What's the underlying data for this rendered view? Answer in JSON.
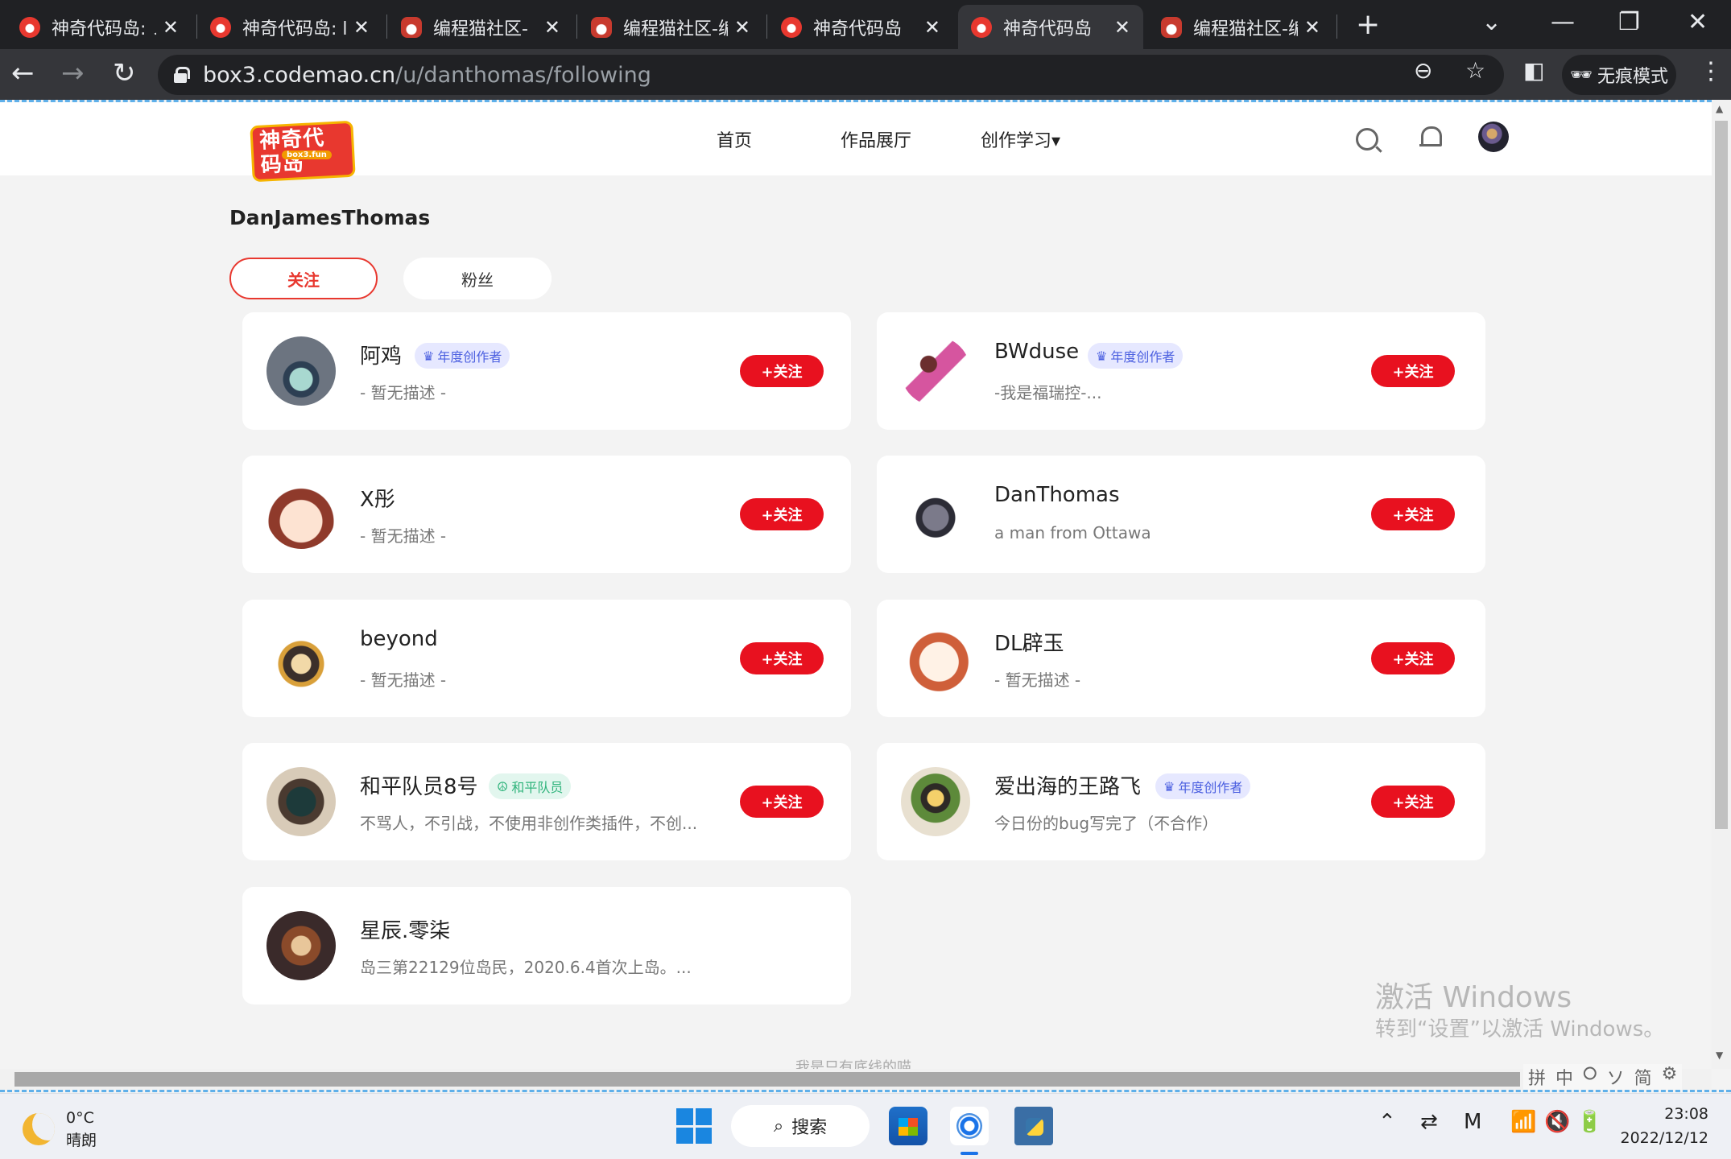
{
  "browser": {
    "tabs": [
      {
        "title": "神奇代码岛: ノ",
        "icon": "red-star",
        "active": false
      },
      {
        "title": "神奇代码岛: l",
        "icon": "red-star",
        "active": false
      },
      {
        "title": "编程猫社区-",
        "icon": "cat",
        "active": false
      },
      {
        "title": "编程猫社区-编",
        "icon": "cat",
        "active": false
      },
      {
        "title": "神奇代码岛",
        "icon": "red-star",
        "active": false
      },
      {
        "title": "神奇代码岛",
        "icon": "red-star",
        "active": true
      },
      {
        "title": "编程猫社区-编",
        "icon": "cat",
        "active": false
      }
    ],
    "url_host": "box3.codemao.cn",
    "url_path": "/u/danthomas/following",
    "incognito_label": "无痕模式"
  },
  "site": {
    "logo_text": "神奇代码岛",
    "logo_sub": "box3.fun",
    "nav": [
      "首页",
      "作品展厅",
      "创作学习▾"
    ]
  },
  "profile": {
    "name": "DanJamesThomas",
    "tabs": [
      "关注",
      "粉丝"
    ]
  },
  "follow_label": "+关注",
  "users": [
    {
      "name": "阿鸡",
      "badge": "年度创作者",
      "badge_type": "blue",
      "desc": "- 暂无描述 -"
    },
    {
      "name": "BWduse",
      "badge": "年度创作者",
      "badge_type": "blue",
      "desc": "-我是福瑞控-..."
    },
    {
      "name": "X彤",
      "badge": "",
      "badge_type": "",
      "desc": "- 暂无描述 -"
    },
    {
      "name": "DanThomas",
      "badge": "",
      "badge_type": "",
      "desc": "a man from Ottawa"
    },
    {
      "name": "beyond",
      "badge": "",
      "badge_type": "",
      "desc": "- 暂无描述 -"
    },
    {
      "name": "DL辟玉",
      "badge": "",
      "badge_type": "",
      "desc": "- 暂无描述 -"
    },
    {
      "name": "和平队员8号",
      "badge": "和平队员",
      "badge_type": "green",
      "desc": "不骂人，不引战，不使用非创作类插件，不创..."
    },
    {
      "name": "爱出海的王路飞",
      "badge": "年度创作者",
      "badge_type": "blue",
      "desc": "今日份的bug写完了（不合作）"
    },
    {
      "name": "星辰.零柒",
      "badge": "",
      "badge_type": "",
      "desc": "岛三第22129位岛民，2020.6.4首次上岛。..."
    }
  ],
  "footer_text": "我是只有底线的喵",
  "watermark": {
    "line1": "激活 Windows",
    "line2": "转到“设置”以激活 Windows。"
  },
  "ime_bar": [
    "拼",
    "中",
    "⭘",
    "ソ",
    "简",
    "⚙"
  ],
  "taskbar": {
    "weather_temp": "0°C",
    "weather_desc": "晴朗",
    "search_label": "搜索",
    "time": "23:08",
    "date": "2022/12/12"
  }
}
